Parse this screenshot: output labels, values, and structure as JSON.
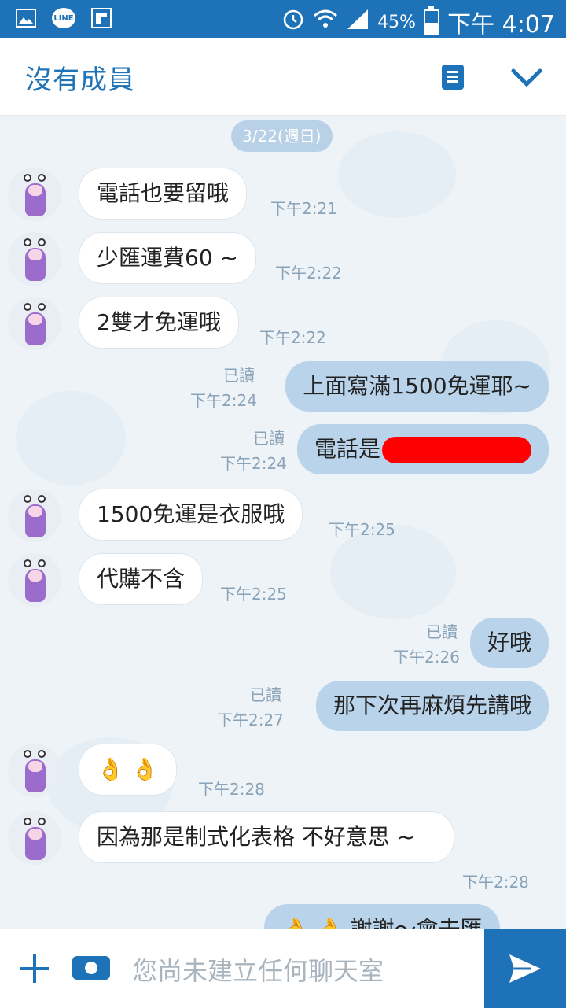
{
  "status_bar": {
    "battery": "45%",
    "time": "下午 4:07"
  },
  "header": {
    "title": "沒有成員"
  },
  "chat": {
    "date_label": "3/22(週日)",
    "messages": [
      {
        "dir": "in",
        "text": "電話也要留哦",
        "time": "下午2:21"
      },
      {
        "dir": "in",
        "text": "少匯運費60 ~",
        "time": "下午2:22"
      },
      {
        "dir": "in",
        "text": "2雙才免運哦",
        "time": "下午2:22"
      },
      {
        "dir": "out",
        "text": "上面寫滿1500免運耶~",
        "time": "下午2:24",
        "read": "已讀"
      },
      {
        "dir": "out",
        "text": "電話是",
        "time": "下午2:24",
        "read": "已讀"
      },
      {
        "dir": "in",
        "text": "1500免運是衣服哦",
        "time": "下午2:25"
      },
      {
        "dir": "in",
        "text": "代購不含",
        "time": "下午2:25"
      },
      {
        "dir": "out",
        "text": "好哦",
        "time": "下午2:26",
        "read": "已讀"
      },
      {
        "dir": "out",
        "text": "那下次再麻煩先講哦",
        "time": "下午2:27",
        "read": "已讀"
      },
      {
        "dir": "in",
        "text": "👌 👌",
        "time": "下午2:28"
      },
      {
        "dir": "in",
        "text": "因為那是制式化表格 不好意思 ~",
        "time": "下午2:28"
      },
      {
        "dir": "out",
        "text": "👌 👌 謝謝～會去匯",
        "time": "",
        "read": ""
      }
    ]
  },
  "input": {
    "placeholder": "您尚未建立任何聊天室"
  }
}
